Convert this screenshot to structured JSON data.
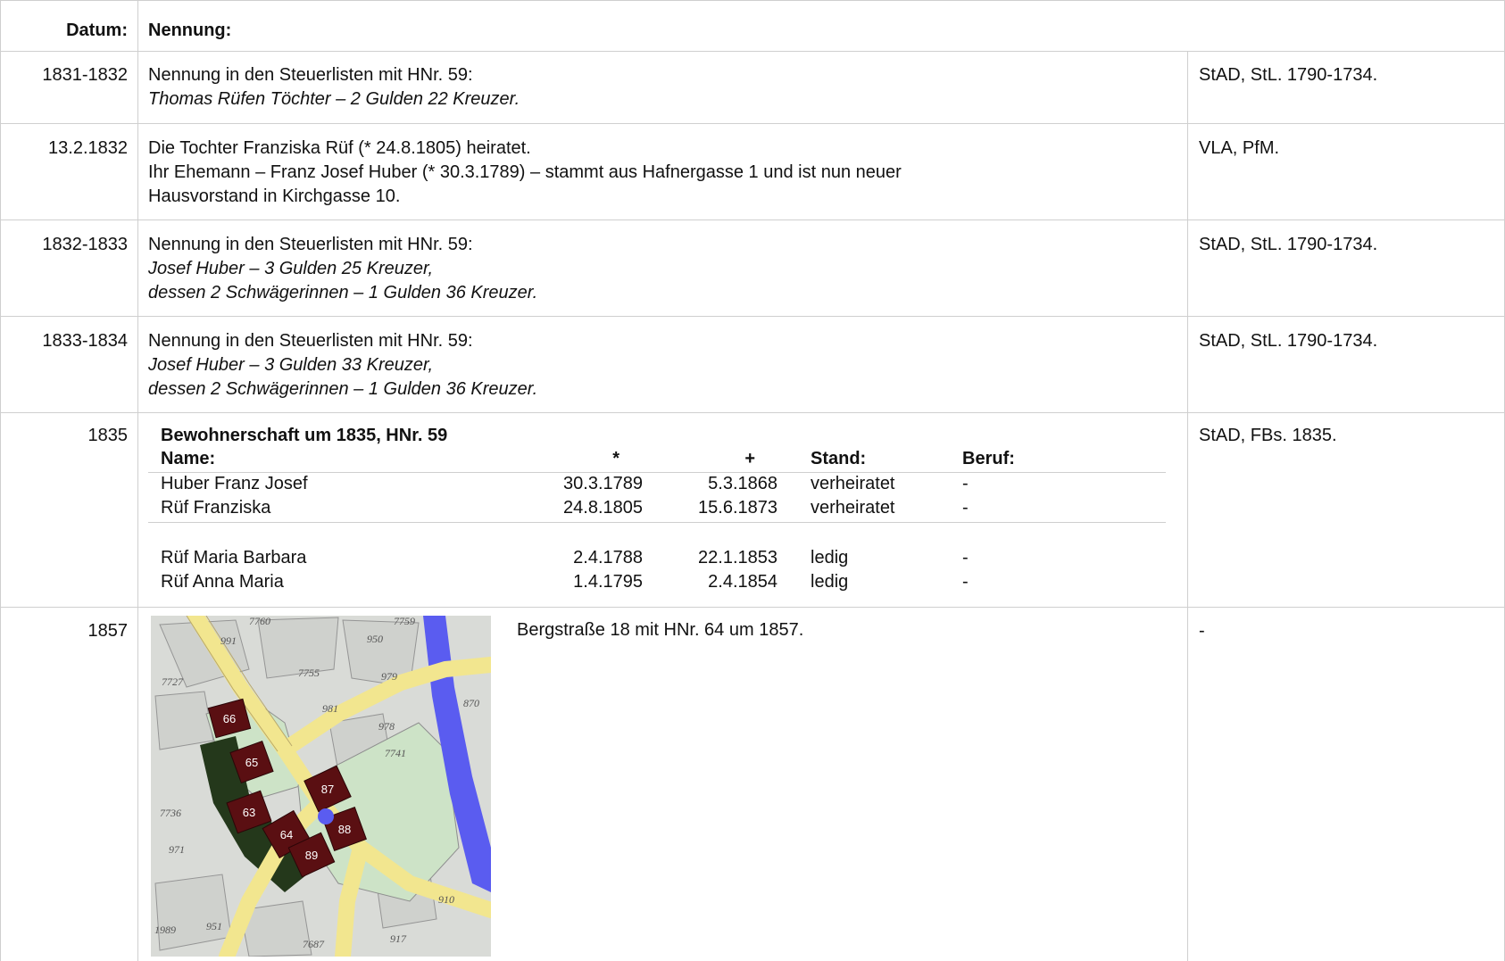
{
  "header": {
    "date_label": "Datum:",
    "text_label": "Nennung:"
  },
  "rows": [
    {
      "date": "1831-1832",
      "lines": [
        "Nennung in den Steuerlisten mit HNr. 59:",
        "Thomas Rüfen Töchter – 2 Gulden 22 Kreuzer."
      ],
      "source": "StAD, StL. 1790-1734."
    },
    {
      "date": "13.2.1832",
      "lines": [
        "Die Tochter Franziska Rüf (* 24.8.1805) heiratet.",
        "Ihr Ehemann – Franz Josef Huber (* 30.3.1789) – stammt aus Hafnergasse 1 und ist nun neuer",
        "Hausvorstand in Kirchgasse 10."
      ],
      "source": "VLA, PfM."
    },
    {
      "date": "1832-1833",
      "lines": [
        "Nennung in den Steuerlisten mit HNr. 59:",
        "Josef Huber – 3 Gulden 25 Kreuzer,",
        "dessen 2 Schwägerinnen – 1 Gulden 36 Kreuzer."
      ],
      "source": "StAD, StL. 1790-1734."
    },
    {
      "date": "1833-1834",
      "lines": [
        "Nennung in den Steuerlisten mit HNr. 59:",
        "Josef Huber – 3 Gulden 33 Kreuzer,",
        "dessen 2 Schwägerinnen – 1 Gulden 36 Kreuzer."
      ],
      "source": "StAD, StL. 1790-1734."
    },
    {
      "date": "1835",
      "title": "Bewohnerschaft um 1835, HNr. 59",
      "columns": {
        "name": "Name:",
        "born": "*",
        "died": "+",
        "stand": "Stand:",
        "beruf": "Beruf:"
      },
      "residents": [
        {
          "name": "Huber Franz Josef",
          "born": "30.3.1789",
          "died": "5.3.1868",
          "stand": "verheiratet",
          "beruf": "-"
        },
        {
          "name": "Rüf Franziska",
          "born": "24.8.1805",
          "died": "15.6.1873",
          "stand": "verheiratet",
          "beruf": "-"
        },
        {
          "name": "Rüf Maria Barbara",
          "born": "2.4.1788",
          "died": "22.1.1853",
          "stand": "ledig",
          "beruf": "-"
        },
        {
          "name": "Rüf Anna Maria",
          "born": "1.4.1795",
          "died": "2.4.1854",
          "stand": "ledig",
          "beruf": "-"
        }
      ],
      "source": "StAD, FBs. 1835."
    },
    {
      "date": "1857",
      "caption": "Bergstraße 18 mit HNr. 64 um 1857.",
      "map": {
        "house_numbers": [
          "66",
          "65",
          "87",
          "63",
          "88",
          "64",
          "89"
        ],
        "parcel_numbers": [
          "991",
          "950",
          "7755",
          "979",
          "7727",
          "981",
          "978",
          "7760",
          "7759",
          "7741",
          "7736",
          "971",
          "910",
          "917",
          "1989",
          "951",
          "7687",
          "870"
        ]
      },
      "source": "-"
    }
  ]
}
